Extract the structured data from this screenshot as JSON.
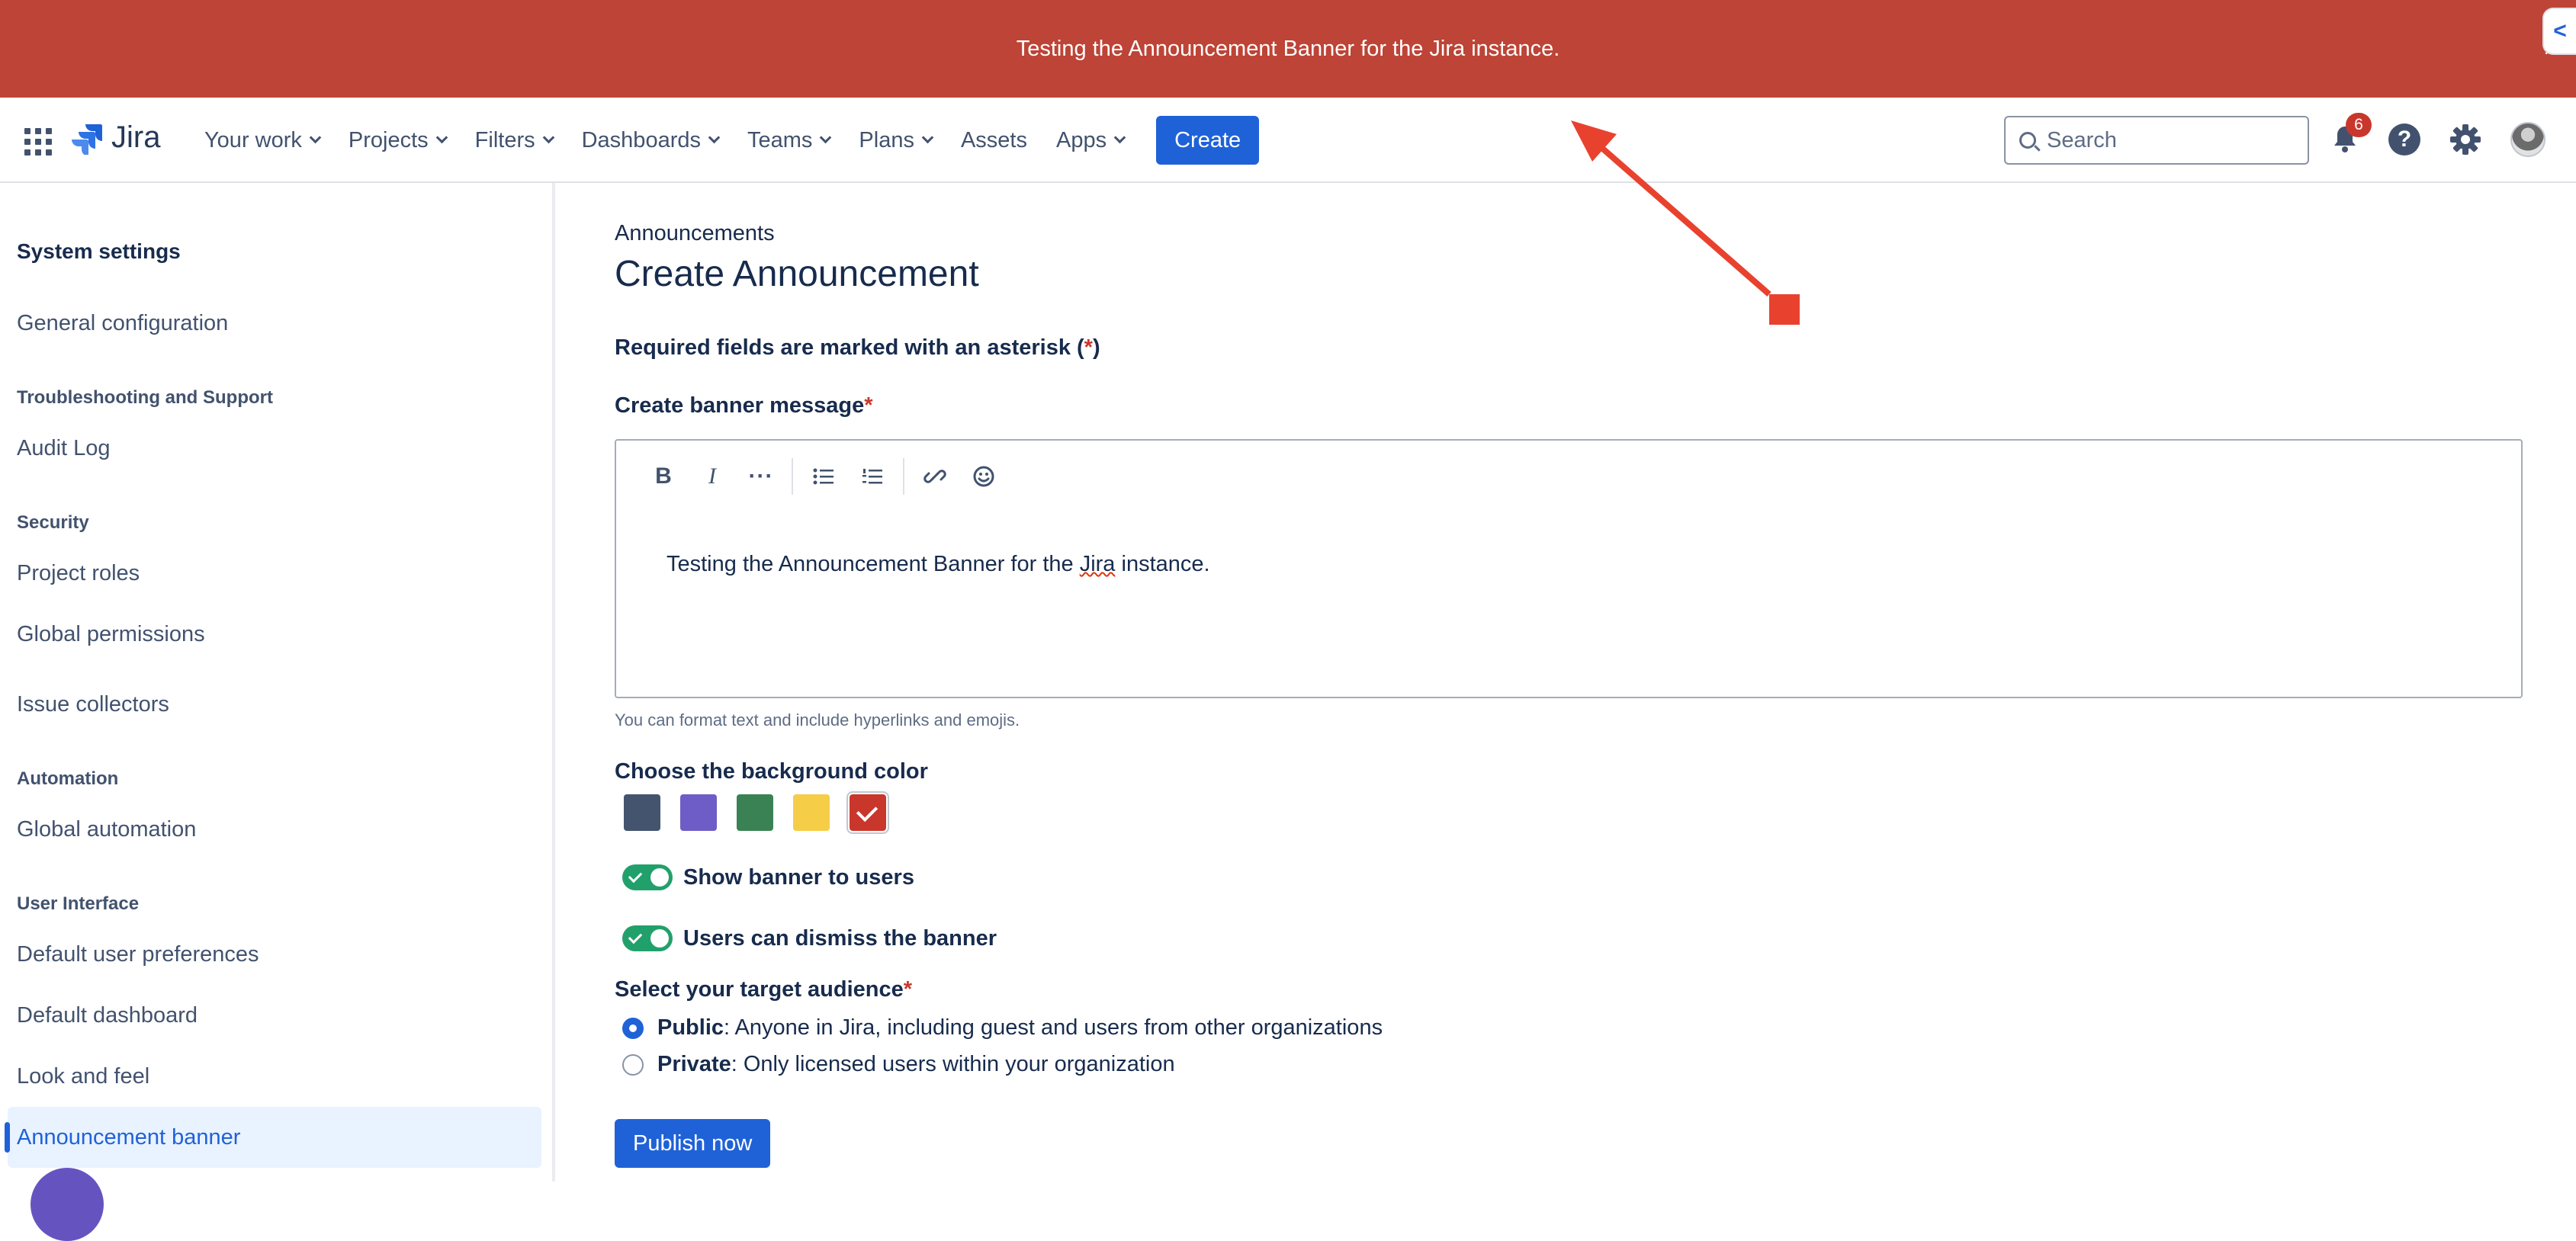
{
  "banner": {
    "message": "Testing the Announcement Banner for the Jira instance.",
    "close": "×",
    "side_tab": "<"
  },
  "colors": {
    "banner": "#bd4436",
    "accent": "#1f62d8",
    "toggle_on": "#22a06b"
  },
  "topnav": {
    "logo_text": "Jira",
    "items": [
      {
        "label": "Your work",
        "has_menu": true
      },
      {
        "label": "Projects",
        "has_menu": true
      },
      {
        "label": "Filters",
        "has_menu": true
      },
      {
        "label": "Dashboards",
        "has_menu": true
      },
      {
        "label": "Teams",
        "has_menu": true
      },
      {
        "label": "Plans",
        "has_menu": true
      },
      {
        "label": "Assets",
        "has_menu": false
      },
      {
        "label": "Apps",
        "has_menu": true
      }
    ],
    "create_label": "Create",
    "search_placeholder": "Search",
    "notification_count": "6",
    "help_glyph": "?",
    "icons": [
      "app-switcher-icon",
      "jira-logo-icon",
      "search-icon",
      "notifications-icon",
      "help-icon",
      "settings-icon",
      "avatar"
    ]
  },
  "sidebar": {
    "title": "System settings",
    "general": "General configuration",
    "groups": {
      "troubleshooting": "Troubleshooting and Support",
      "security": "Security",
      "automation": "Automation",
      "ui": "User Interface"
    },
    "items": {
      "audit_log": "Audit Log",
      "project_roles": "Project roles",
      "global_permissions": "Global permissions",
      "issue_collectors": "Issue collectors",
      "global_automation": "Global automation",
      "default_user_prefs": "Default user preferences",
      "default_dashboard": "Default dashboard",
      "look_and_feel": "Look and feel",
      "announcement_banner": "Announcement banner"
    }
  },
  "main": {
    "breadcrumb": "Announcements",
    "title": "Create Announcement",
    "required_note_prefix": "Required fields are marked with an asterisk (",
    "required_note_star": "*",
    "required_note_suffix": ")",
    "message_label": "Create banner message",
    "editor_text_before": "Testing the Announcement Banner for the ",
    "editor_text_flagged": "Jira",
    "editor_text_after": " instance.",
    "hint": "You can format text and include hyperlinks and emojis.",
    "color_label": "Choose the background color",
    "swatches": [
      {
        "name": "navy",
        "color": "#44546f",
        "selected": false
      },
      {
        "name": "purple",
        "color": "#6e5dc6",
        "selected": false
      },
      {
        "name": "green",
        "color": "#3a8254",
        "selected": false
      },
      {
        "name": "yellow",
        "color": "#f5cd47",
        "selected": false
      },
      {
        "name": "red",
        "color": "#c9372c",
        "selected": true
      }
    ],
    "toggle_show_label": "Show banner to users",
    "toggle_show_on": true,
    "toggle_dismiss_label": "Users can dismiss the banner",
    "toggle_dismiss_on": true,
    "audience_label": "Select your target audience",
    "audience_public_title": "Public",
    "audience_public_desc": ": Anyone in Jira, including guest and users from other organizations",
    "audience_private_title": "Private",
    "audience_private_desc": ": Only licensed users within your organization",
    "audience_selected": "Public",
    "publish_label": "Publish now"
  }
}
